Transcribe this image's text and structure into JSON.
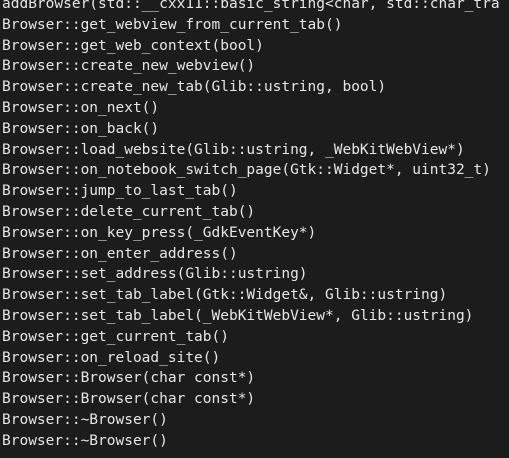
{
  "terminal": {
    "background": "#1c1c1c",
    "foreground": "#e6e6e6",
    "lines": [
      "addBrowser(std::__cxx11::basic_string<char, std::char_tra",
      "Browser::get_webview_from_current_tab()",
      "Browser::get_web_context(bool)",
      "Browser::create_new_webview()",
      "Browser::create_new_tab(Glib::ustring, bool)",
      "Browser::on_next()",
      "Browser::on_back()",
      "Browser::load_website(Glib::ustring, _WebKitWebView*)",
      "Browser::on_notebook_switch_page(Gtk::Widget*, uint32_t)",
      "Browser::jump_to_last_tab()",
      "Browser::delete_current_tab()",
      "Browser::on_key_press(_GdkEventKey*)",
      "Browser::on_enter_address()",
      "Browser::set_address(Glib::ustring)",
      "Browser::set_tab_label(Gtk::Widget&, Glib::ustring)",
      "Browser::set_tab_label(_WebKitWebView*, Glib::ustring)",
      "Browser::get_current_tab()",
      "Browser::on_reload_site()",
      "Browser::Browser(char const*)",
      "Browser::Browser(char const*)",
      "Browser::~Browser()",
      "Browser::~Browser()"
    ]
  }
}
